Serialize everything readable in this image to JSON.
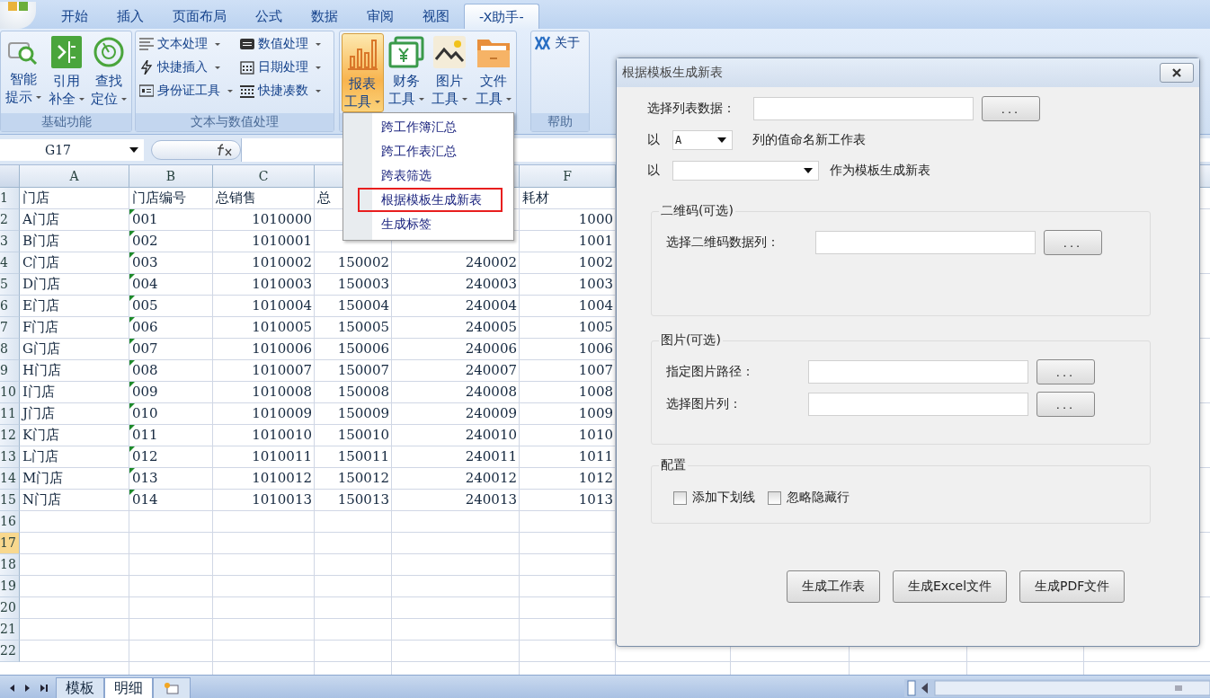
{
  "tabs": [
    {
      "label": "开始",
      "selected": false
    },
    {
      "label": "插入",
      "selected": false
    },
    {
      "label": "页面布局",
      "selected": false
    },
    {
      "label": "公式",
      "selected": false
    },
    {
      "label": "数据",
      "selected": false
    },
    {
      "label": "审阅",
      "selected": false
    },
    {
      "label": "视图",
      "selected": false
    },
    {
      "label": "-X助手-",
      "selected": true
    }
  ],
  "ribbon": {
    "groups": [
      {
        "label": "基础功能",
        "kind": "large",
        "buttons": [
          {
            "line1": "智能",
            "line2": "提示",
            "pressed": false
          },
          {
            "line1": "引用",
            "line2": "补全",
            "pressed": false
          },
          {
            "line1": "查找",
            "line2": "定位",
            "pressed": false
          }
        ]
      },
      {
        "label": "文本与数值处理",
        "kind": "small",
        "buttons": [
          {
            "label": "文本处理",
            "pressed": false
          },
          {
            "label": "数值处理",
            "pressed": false
          },
          {
            "label": "快捷插入",
            "pressed": false
          },
          {
            "label": "日期处理",
            "pressed": false
          },
          {
            "label": "身份证工具",
            "pressed": false
          },
          {
            "label": "快捷凑数",
            "pressed": false
          }
        ]
      },
      {
        "kind": "large",
        "buttons": [
          {
            "line1": "报表",
            "line2": "工具",
            "pressed": true
          },
          {
            "line1": "财务",
            "line2": "工具",
            "pressed": false
          },
          {
            "line1": "图片",
            "line2": "工具",
            "pressed": false
          },
          {
            "line1": "文件",
            "line2": "工具",
            "pressed": false
          }
        ]
      },
      {
        "label": "帮助",
        "kind": "about",
        "buttons": [
          {
            "label": "关于",
            "pressed": false
          }
        ]
      }
    ]
  },
  "menu": {
    "items": [
      {
        "label": "跨工作簿汇总",
        "selected": false
      },
      {
        "label": "跨工作表汇总",
        "selected": false
      },
      {
        "label": "跨表筛选",
        "selected": false
      },
      {
        "label": "根据模板生成新表",
        "selected": true
      },
      {
        "label": "生成标签",
        "selected": false
      }
    ]
  },
  "formula_bar": {
    "name_box": "G17"
  },
  "sheet": {
    "columns": [
      {
        "letter": "A"
      },
      {
        "letter": "B"
      },
      {
        "letter": "C"
      },
      {},
      {},
      {
        "letter": "F"
      }
    ],
    "rows": [
      {
        "header": "1",
        "kind": "header",
        "cells": {
          "a": "门店",
          "b": "门店编号",
          "c": "总销售",
          "d": "总",
          "f": "耗材"
        }
      },
      {
        "header": "2",
        "kind": "data",
        "flag": true,
        "cells": {
          "a": "A门店",
          "b": "001",
          "c": "1010000",
          "f": "1000"
        }
      },
      {
        "header": "3",
        "kind": "data",
        "flag": true,
        "cells": {
          "a": "B门店",
          "b": "002",
          "c": "1010001",
          "f": "1001"
        }
      },
      {
        "header": "4",
        "kind": "data",
        "flag": true,
        "cells": {
          "a": "C门店",
          "b": "003",
          "c": "1010002",
          "d": "150002",
          "e": "240002",
          "f": "1002"
        }
      },
      {
        "header": "5",
        "kind": "data",
        "flag": true,
        "cells": {
          "a": "D门店",
          "b": "004",
          "c": "1010003",
          "d": "150003",
          "e": "240003",
          "f": "1003"
        }
      },
      {
        "header": "6",
        "kind": "data",
        "flag": true,
        "cells": {
          "a": "E门店",
          "b": "005",
          "c": "1010004",
          "d": "150004",
          "e": "240004",
          "f": "1004"
        }
      },
      {
        "header": "7",
        "kind": "data",
        "flag": true,
        "cells": {
          "a": "F门店",
          "b": "006",
          "c": "1010005",
          "d": "150005",
          "e": "240005",
          "f": "1005"
        }
      },
      {
        "header": "8",
        "kind": "data",
        "flag": true,
        "cells": {
          "a": "G门店",
          "b": "007",
          "c": "1010006",
          "d": "150006",
          "e": "240006",
          "f": "1006"
        }
      },
      {
        "header": "9",
        "kind": "data",
        "flag": true,
        "cells": {
          "a": "H门店",
          "b": "008",
          "c": "1010007",
          "d": "150007",
          "e": "240007",
          "f": "1007"
        }
      },
      {
        "header": "10",
        "kind": "data",
        "flag": true,
        "cells": {
          "a": "I门店",
          "b": "009",
          "c": "1010008",
          "d": "150008",
          "e": "240008",
          "f": "1008"
        }
      },
      {
        "header": "11",
        "kind": "data",
        "flag": true,
        "cells": {
          "a": "J门店",
          "b": "010",
          "c": "1010009",
          "d": "150009",
          "e": "240009",
          "f": "1009"
        }
      },
      {
        "header": "12",
        "kind": "data",
        "flag": true,
        "cells": {
          "a": "K门店",
          "b": "011",
          "c": "1010010",
          "d": "150010",
          "e": "240010",
          "f": "1010"
        }
      },
      {
        "header": "13",
        "kind": "data",
        "flag": true,
        "cells": {
          "a": "L门店",
          "b": "012",
          "c": "1010011",
          "d": "150011",
          "e": "240011",
          "f": "1011"
        }
      },
      {
        "header": "14",
        "kind": "data",
        "flag": true,
        "cells": {
          "a": "M门店",
          "b": "013",
          "c": "1010012",
          "d": "150012",
          "e": "240012",
          "f": "1012"
        }
      },
      {
        "header": "15",
        "kind": "data",
        "flag": true,
        "cells": {
          "a": "N门店",
          "b": "014",
          "c": "1010013",
          "d": "150013",
          "e": "240013",
          "f": "1013"
        }
      },
      {
        "header": "16",
        "selected": false
      },
      {
        "header": "17",
        "selected": true
      },
      {
        "header": "18",
        "selected": false
      },
      {
        "header": "19",
        "selected": false
      },
      {
        "header": "20",
        "selected": false
      },
      {
        "header": "21",
        "selected": false
      },
      {
        "header": "22",
        "selected": false
      }
    ]
  },
  "sheet_tabs": [
    {
      "label": "模板",
      "selected": false
    },
    {
      "label": "明细",
      "selected": true
    }
  ],
  "dialog": {
    "title": "根据模板生成新表",
    "list_data": {
      "label": "选择列表数据：",
      "button": "..."
    },
    "name_row": {
      "prefix": "以",
      "value": "A",
      "suffix": "列的值命名新工作表"
    },
    "template_row": {
      "prefix": "以",
      "suffix": "作为模板生成新表"
    },
    "groups": [
      {
        "title": "二维码(可选)",
        "kind": "fields",
        "fields": [
          {
            "label": "选择二维码数据列：",
            "button": "..."
          }
        ]
      },
      {
        "title": "图片(可选)",
        "kind": "fields",
        "fields": [
          {
            "label": "指定图片路径：",
            "button": "..."
          },
          {
            "label": "选择图片列：",
            "button": "..."
          }
        ]
      },
      {
        "title": "配置",
        "kind": "checkboxes",
        "checkboxes": [
          {
            "label": "添加下划线",
            "checked": false
          },
          {
            "label": "忽略隐藏行",
            "checked": false
          }
        ]
      }
    ],
    "buttons": [
      "生成工作表",
      "生成Excel文件",
      "生成PDF文件"
    ]
  }
}
